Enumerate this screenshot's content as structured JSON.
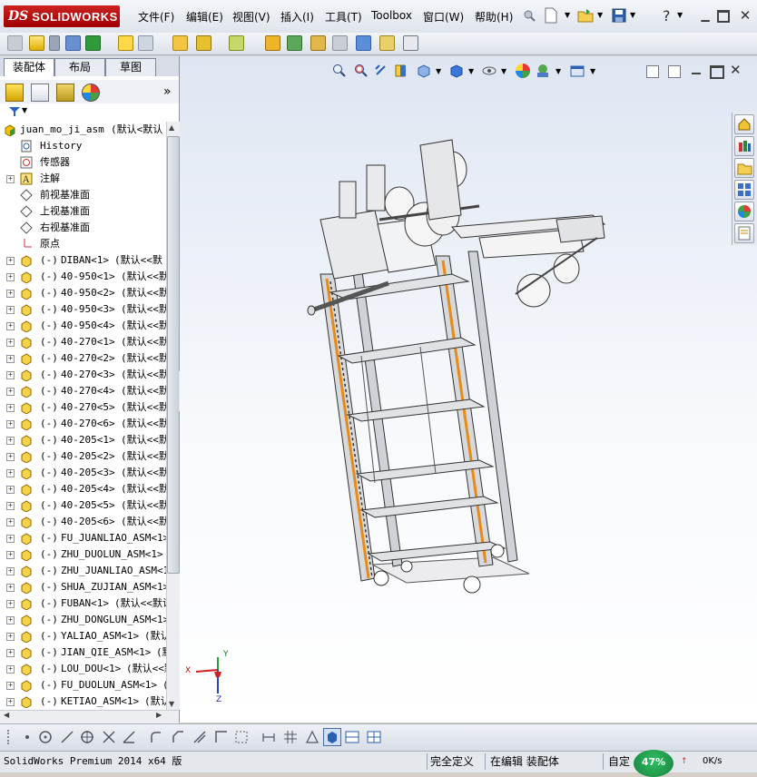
{
  "app": {
    "logo_ds": "DS",
    "logo_name": "SOLIDWORKS"
  },
  "menu": [
    {
      "label": "文件(F)"
    },
    {
      "label": "编辑(E)"
    },
    {
      "label": "视图(V)"
    },
    {
      "label": "插入(I)"
    },
    {
      "label": "工具(T)"
    },
    {
      "label": "Toolbox"
    },
    {
      "label": "窗口(W)"
    },
    {
      "label": "帮助(H)"
    }
  ],
  "help_symbol": "?",
  "tabs": [
    {
      "label": "装配体"
    },
    {
      "label": "布局"
    },
    {
      "label": "草图"
    }
  ],
  "tree": {
    "root": {
      "name": "juan_mo_ji_asm",
      "suffix": "(默认<默认"
    },
    "fixed": [
      {
        "label": "History"
      },
      {
        "label": "传感器"
      },
      {
        "label": "注解"
      },
      {
        "label": "前视基准面"
      },
      {
        "label": "上视基准面"
      },
      {
        "label": "右视基准面"
      },
      {
        "label": "原点"
      }
    ],
    "parts": [
      {
        "prefix": "(-)",
        "name": "DIBAN<1>",
        "suffix": "(默认<<默"
      },
      {
        "prefix": "(-)",
        "name": "40-950<1>",
        "suffix": "(默认<<默"
      },
      {
        "prefix": "(-)",
        "name": "40-950<2>",
        "suffix": "(默认<<默"
      },
      {
        "prefix": "(-)",
        "name": "40-950<3>",
        "suffix": "(默认<<默"
      },
      {
        "prefix": "(-)",
        "name": "40-950<4>",
        "suffix": "(默认<<默"
      },
      {
        "prefix": "(-)",
        "name": "40-270<1>",
        "suffix": "(默认<<默"
      },
      {
        "prefix": "(-)",
        "name": "40-270<2>",
        "suffix": "(默认<<默"
      },
      {
        "prefix": "(-)",
        "name": "40-270<3>",
        "suffix": "(默认<<默"
      },
      {
        "prefix": "(-)",
        "name": "40-270<4>",
        "suffix": "(默认<<默"
      },
      {
        "prefix": "(-)",
        "name": "40-270<5>",
        "suffix": "(默认<<默"
      },
      {
        "prefix": "(-)",
        "name": "40-270<6>",
        "suffix": "(默认<<默"
      },
      {
        "prefix": "(-)",
        "name": "40-205<1>",
        "suffix": "(默认<<默"
      },
      {
        "prefix": "(-)",
        "name": "40-205<2>",
        "suffix": "(默认<<默"
      },
      {
        "prefix": "(-)",
        "name": "40-205<3>",
        "suffix": "(默认<<默"
      },
      {
        "prefix": "(-)",
        "name": "40-205<4>",
        "suffix": "(默认<<默"
      },
      {
        "prefix": "(-)",
        "name": "40-205<5>",
        "suffix": "(默认<<默"
      },
      {
        "prefix": "(-)",
        "name": "40-205<6>",
        "suffix": "(默认<<默"
      },
      {
        "prefix": "(-)",
        "name": "FU_JUANLIAO_ASM<1>",
        "suffix": ""
      },
      {
        "prefix": "(-)",
        "name": "ZHU_DUOLUN_ASM<1>",
        "suffix": "("
      },
      {
        "prefix": "(-)",
        "name": "ZHU_JUANLIAO_ASM<1>",
        "suffix": ""
      },
      {
        "prefix": "(-)",
        "name": "SHUA_ZUJIAN_ASM<1>",
        "suffix": ""
      },
      {
        "prefix": "(-)",
        "name": "FUBAN<1>",
        "suffix": "(默认<<默认"
      },
      {
        "prefix": "(-)",
        "name": "ZHU_DONGLUN_ASM<1>",
        "suffix": ""
      },
      {
        "prefix": "(-)",
        "name": "YALIAO_ASM<1>",
        "suffix": "(默认"
      },
      {
        "prefix": "(-)",
        "name": "JIAN_QIE_ASM<1>",
        "suffix": "(默"
      },
      {
        "prefix": "(-)",
        "name": "LOU_DOU<1>",
        "suffix": "(默认<<默"
      },
      {
        "prefix": "(-)",
        "name": "FU_DUOLUN_ASM<1>",
        "suffix": "(默"
      },
      {
        "prefix": "(-)",
        "name": "KETIAO_ASM<1>",
        "suffix": "(默认"
      }
    ]
  },
  "triad": {
    "x": "X",
    "y": "Y",
    "z": "Z"
  },
  "status": {
    "product": "SolidWorks Premium 2014 x64 版",
    "defined": "完全定义",
    "editing": "在编辑 装配体",
    "custom": "自定",
    "percent": "47%",
    "speed": "0K/s"
  },
  "colors": {
    "accent_red": "#b30000",
    "tree_icon_yellow": "#f2c200",
    "status_green": "#1f9a4b"
  }
}
